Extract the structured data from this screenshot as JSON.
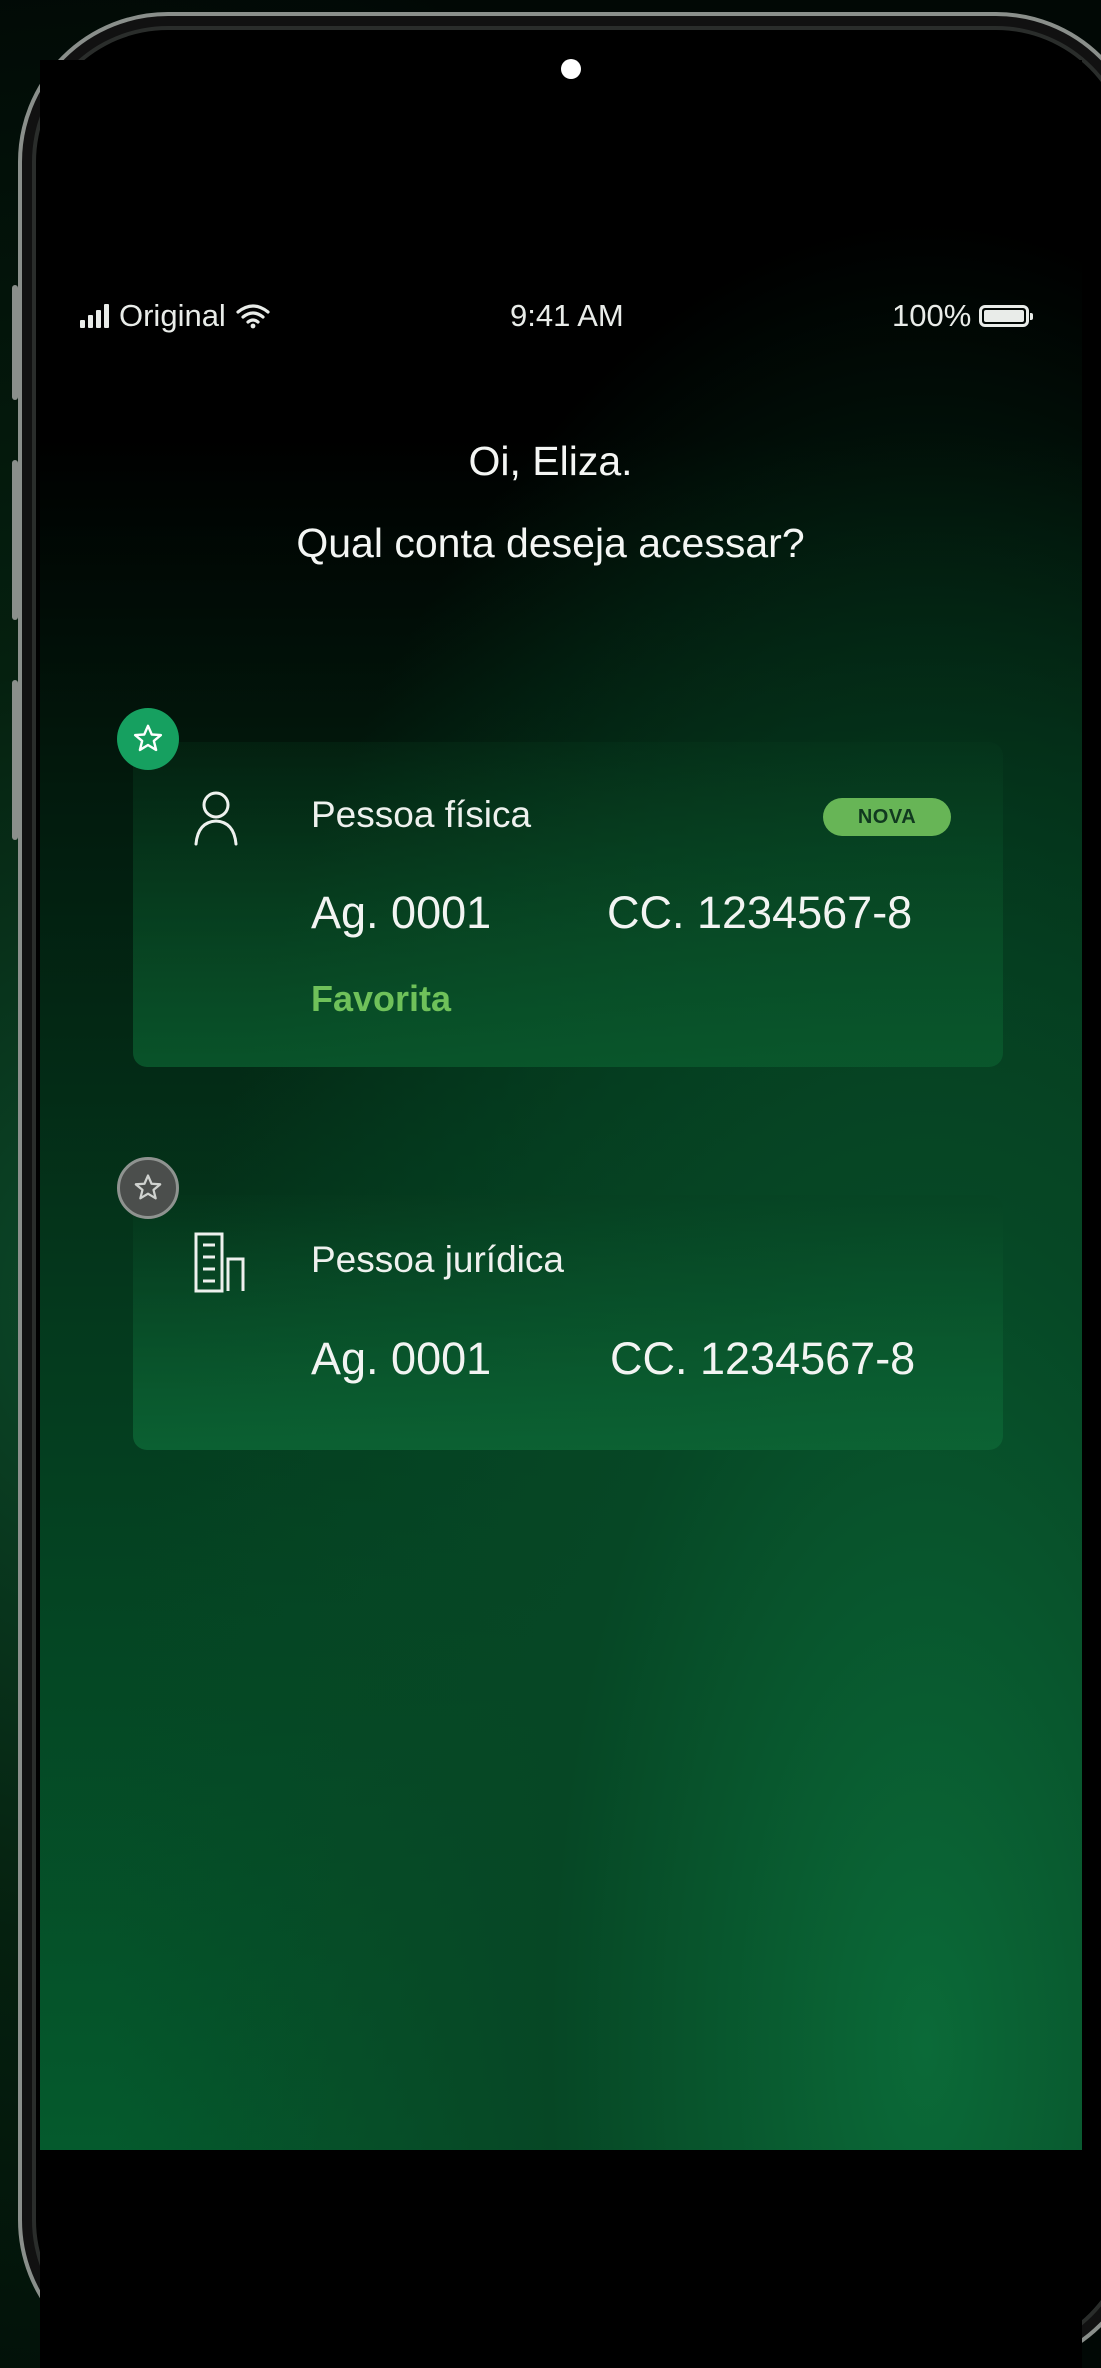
{
  "status_bar": {
    "carrier": "Original",
    "time": "9:41 AM",
    "battery": "100%"
  },
  "greeting": {
    "line1": "Oi, Eliza.",
    "line2": "Qual conta deseja acessar?"
  },
  "accounts": [
    {
      "type": "Pessoa física",
      "agency": "Ag. 0001",
      "account": "CC. 1234567-8",
      "favorite_label": "Favorita",
      "badge": "NOVA",
      "icon": "person-icon",
      "favorite": true
    },
    {
      "type": "Pessoa jurídica",
      "agency": "Ag. 0001",
      "account": "CC. 1234567-8",
      "icon": "building-icon",
      "favorite": false
    }
  ],
  "colors": {
    "accent_green": "#16a060",
    "favorite_text": "#6fc15a",
    "badge_bg": "#67b556"
  }
}
